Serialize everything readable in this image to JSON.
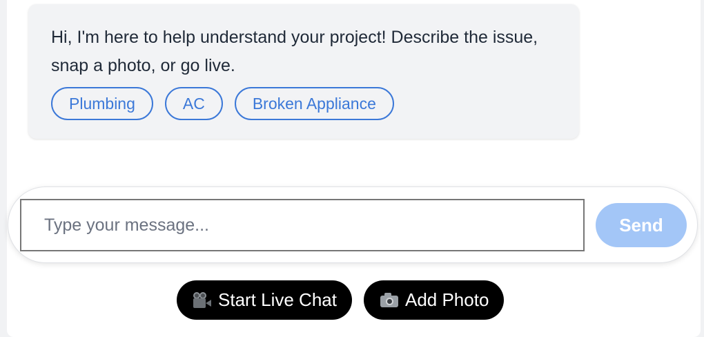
{
  "chat": {
    "greeting": "Hi, I'm here to help understand your project! Describe the issue, snap a photo, or go live.",
    "quick_replies": [
      {
        "label": "Plumbing"
      },
      {
        "label": "AC"
      },
      {
        "label": "Broken Appliance"
      }
    ]
  },
  "composer": {
    "placeholder": "Type your message...",
    "value": "",
    "send_label": "Send"
  },
  "actions": {
    "live_chat": {
      "label": "Start Live Chat",
      "icon": "movie-camera-icon"
    },
    "add_photo": {
      "label": "Add Photo",
      "icon": "camera-icon"
    }
  },
  "colors": {
    "accent": "#3b78d8",
    "send_disabled": "#a3c6f7",
    "action_bg": "#000000",
    "bubble_bg": "#f2f3f5"
  }
}
